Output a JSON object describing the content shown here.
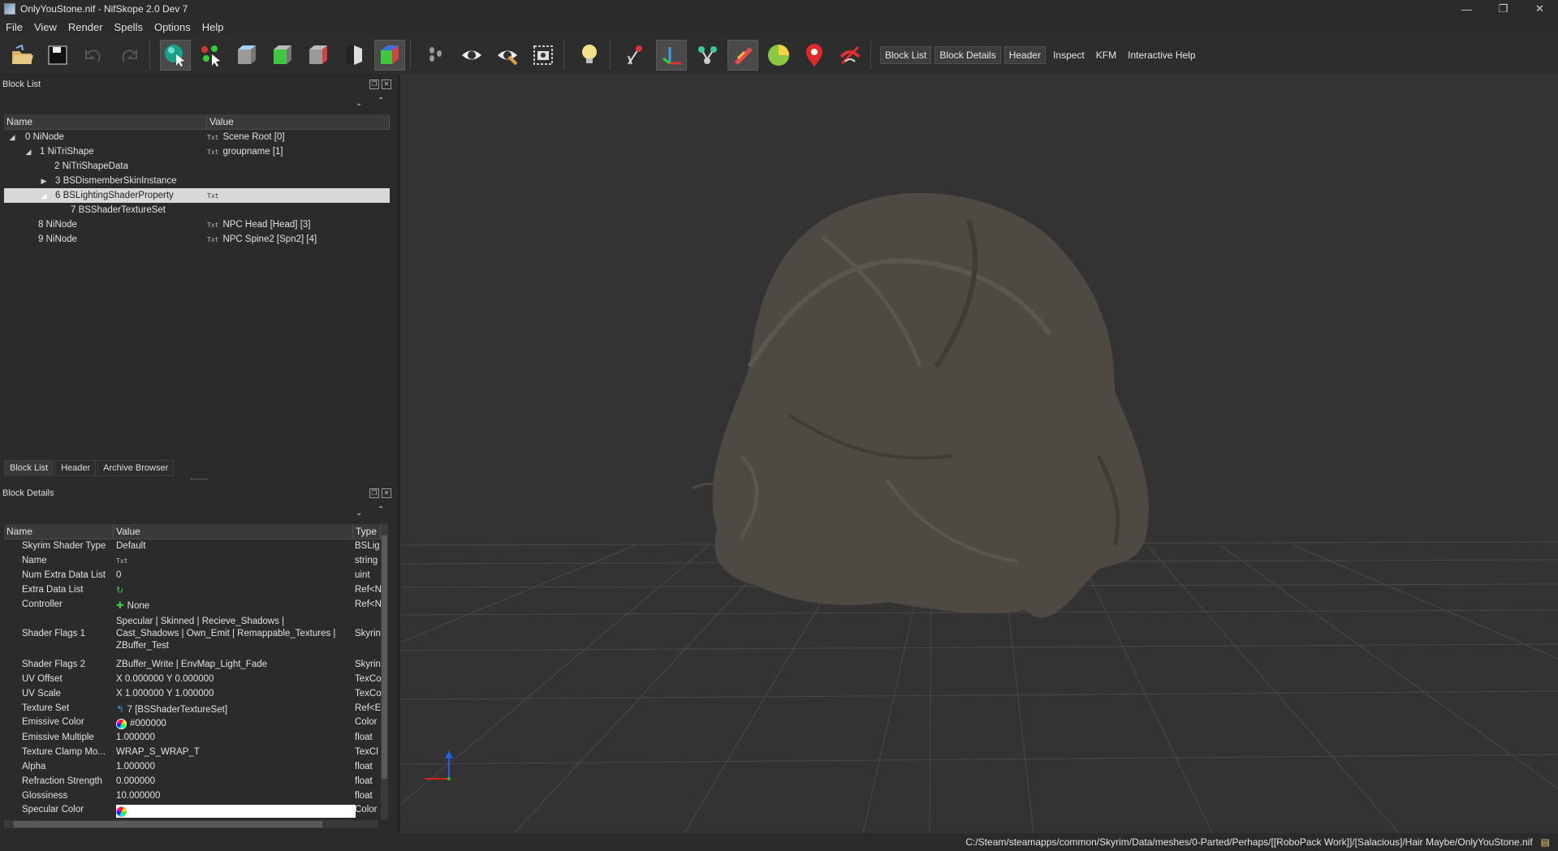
{
  "window": {
    "title": "OnlyYouStone.nif - NifSkope 2.0 Dev 7"
  },
  "menu": [
    "File",
    "View",
    "Render",
    "Spells",
    "Options",
    "Help"
  ],
  "toolbar": {
    "icons": [
      "load-icon",
      "save-icon",
      "undo-icon",
      "redo-icon",
      "select-object-icon",
      "select-vertex-icon",
      "view-top-icon",
      "view-front-icon",
      "view-side-icon",
      "view-user-icon",
      "view-walk-icon",
      "flip-view-icon",
      "show-hidden-icon",
      "show-constraints-icon",
      "screenshot-icon",
      "lighting-icon",
      "show-nodes-icon",
      "show-axes-icon",
      "show-markers-icon",
      "show-havok-icon",
      "show-furniture-icon",
      "show-marker-icon",
      "disable-shading-icon"
    ],
    "text_buttons": [
      "Block List",
      "Block Details",
      "Header",
      "Inspect",
      "KFM",
      "Interactive Help"
    ]
  },
  "block_list": {
    "title": "Block List",
    "columns": [
      "Name",
      "Value"
    ],
    "rows": [
      {
        "name": "0 NiNode",
        "value": "Scene Root [0]"
      },
      {
        "name": "1 NiTriShape",
        "value": "groupname [1]"
      },
      {
        "name": "2 NiTriShapeData",
        "value": ""
      },
      {
        "name": "3 BSDismemberSkinInstance",
        "value": ""
      },
      {
        "name": "6 BSLightingShaderProperty",
        "value": ""
      },
      {
        "name": "7 BSShaderTextureSet",
        "value": ""
      },
      {
        "name": "8 NiNode",
        "value": "NPC Head [Head] [3]"
      },
      {
        "name": "9 NiNode",
        "value": "NPC Spine2 [Spn2] [4]"
      }
    ],
    "tag_text": "Txt"
  },
  "tabs": [
    "Block List",
    "Header",
    "Archive Browser"
  ],
  "block_details": {
    "title": "Block Details",
    "columns": [
      "Name",
      "Value",
      "Type"
    ],
    "rows": [
      {
        "name": "Skyrim Shader Type",
        "value": "Default",
        "type": "BSLig"
      },
      {
        "name": "Name",
        "value": "",
        "type": "string"
      },
      {
        "name": "Num Extra Data List",
        "value": "0",
        "type": "uint"
      },
      {
        "name": "Extra Data List",
        "value": "",
        "type": "Ref<N"
      },
      {
        "name": "Controller",
        "value": "None",
        "type": "Ref<N"
      },
      {
        "name": "Shader Flags 1",
        "value": "Specular | Skinned | Recieve_Shadows | Cast_Shadows | Own_Emit | Remappable_Textures | ZBuffer_Test",
        "type": "Skyrin"
      },
      {
        "name": "Shader Flags 2",
        "value": "ZBuffer_Write | EnvMap_Light_Fade",
        "type": "Skyrin"
      },
      {
        "name": "UV Offset",
        "value": "X 0.000000 Y 0.000000",
        "type": "TexCo"
      },
      {
        "name": "UV Scale",
        "value": "X 1.000000 Y 1.000000",
        "type": "TexCo"
      },
      {
        "name": "Texture Set",
        "value": "7 [BSShaderTextureSet]",
        "type": "Ref<E"
      },
      {
        "name": "Emissive Color",
        "value": "#000000",
        "type": "Color"
      },
      {
        "name": "Emissive Multiple",
        "value": "1.000000",
        "type": "float"
      },
      {
        "name": "Texture Clamp Mo...",
        "value": "WRAP_S_WRAP_T",
        "type": "TexCl"
      },
      {
        "name": "Alpha",
        "value": "1.000000",
        "type": "float"
      },
      {
        "name": "Refraction Strength",
        "value": "0.000000",
        "type": "float"
      },
      {
        "name": "Glossiness",
        "value": "10.000000",
        "type": "float"
      },
      {
        "name": "Specular Color",
        "value": "",
        "type": "Color"
      }
    ]
  },
  "status": {
    "path": "C:/Steam/steamapps/common/Skyrim/Data/meshes/0-Parted/Perhaps/[[RoboPack Work]]/[Salacious]/Hair Maybe/OnlyYouStone.nif"
  },
  "colors": {
    "emissive": "#000000",
    "specular": "#ffffff",
    "selection": "#d8d8d8",
    "viewport_bg": "#333333",
    "model": "#4e4a43"
  }
}
